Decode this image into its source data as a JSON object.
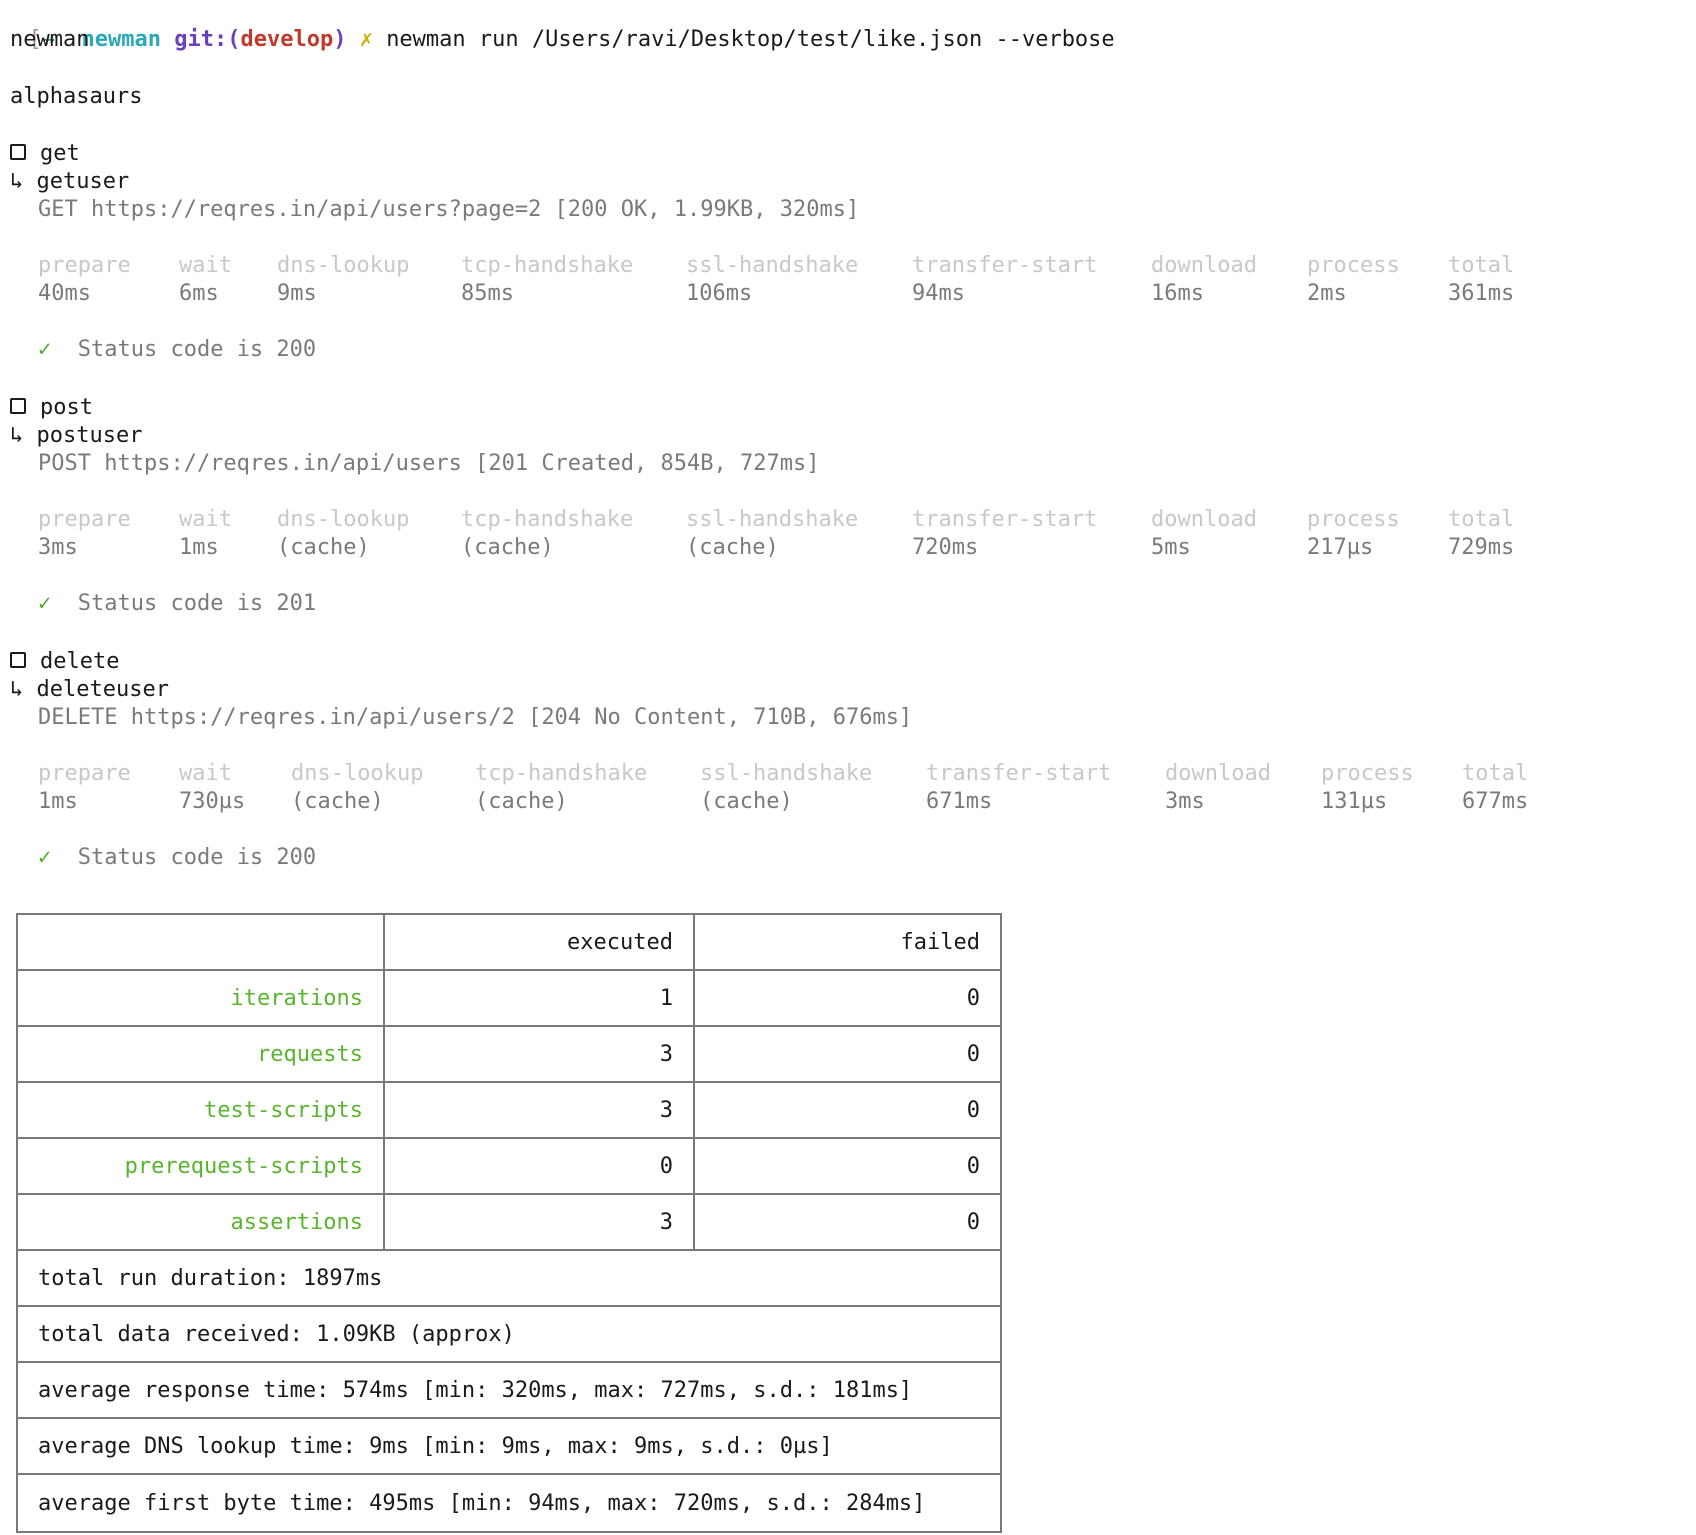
{
  "prompt": {
    "arrow": "→",
    "dir": "newman",
    "git_label": "git:(",
    "branch": "develop",
    "git_close": ")",
    "dirty_mark": "✗",
    "command": "newman run /Users/ravi/Desktop/test/like.json --verbose"
  },
  "header": {
    "app": "newman",
    "collection": "alphasaurs"
  },
  "timing_labels": [
    "prepare",
    "wait",
    "dns-lookup",
    "tcp-handshake",
    "ssl-handshake",
    "transfer-start",
    "download",
    "process",
    "total"
  ],
  "folders": [
    {
      "folder": "get",
      "request": "getuser",
      "summary": "GET https://reqres.in/api/users?page=2 [200 OK, 1.99KB, 320ms]",
      "timings": [
        "40ms",
        "6ms",
        "9ms",
        "85ms",
        "106ms",
        "94ms",
        "16ms",
        "2ms",
        "361ms"
      ],
      "assertion": "Status code is 200"
    },
    {
      "folder": "post",
      "request": "postuser",
      "summary": "POST https://reqres.in/api/users [201 Created, 854B, 727ms]",
      "timings": [
        "3ms",
        "1ms",
        "(cache)",
        "(cache)",
        "(cache)",
        "720ms",
        "5ms",
        "217µs",
        "729ms"
      ],
      "assertion": "Status code is 201"
    },
    {
      "folder": "delete",
      "request": "deleteuser",
      "summary": "DELETE https://reqres.in/api/users/2 [204 No Content, 710B, 676ms]",
      "timings": [
        "1ms",
        "730µs",
        "(cache)",
        "(cache)",
        "(cache)",
        "671ms",
        "3ms",
        "131µs",
        "677ms"
      ],
      "assertion": "Status code is 200"
    }
  ],
  "check_glyph": "✓",
  "summary_table": {
    "headers": [
      "",
      "executed",
      "failed"
    ],
    "rows": [
      {
        "label": "iterations",
        "executed": "1",
        "failed": "0"
      },
      {
        "label": "requests",
        "executed": "3",
        "failed": "0"
      },
      {
        "label": "test-scripts",
        "executed": "3",
        "failed": "0"
      },
      {
        "label": "prerequest-scripts",
        "executed": "0",
        "failed": "0"
      },
      {
        "label": "assertions",
        "executed": "3",
        "failed": "0"
      }
    ],
    "stats": [
      "total run duration: 1897ms",
      "total data received: 1.09KB (approx)",
      "average response time: 574ms [min: 320ms, max: 727ms, s.d.: 181ms]",
      "average DNS lookup time: 9ms [min: 9ms, max: 9ms, s.d.: 0µs]",
      "average first byte time: 495ms [min: 94ms, max: 720ms, s.d.: 284ms]"
    ]
  }
}
